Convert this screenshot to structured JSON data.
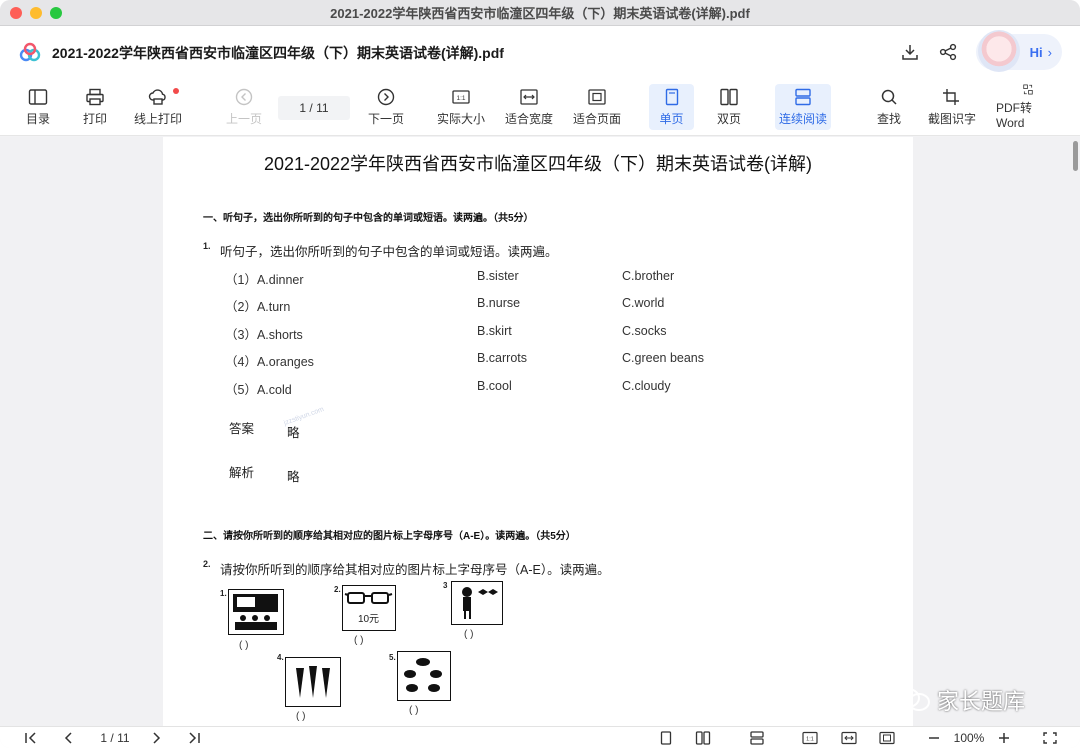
{
  "window": {
    "title": "2021-2022学年陕西省西安市临潼区四年级（下）期末英语试卷(详解).pdf"
  },
  "header": {
    "doc_title": "2021-2022学年陕西省西安市临潼区四年级（下）期末英语试卷(详解).pdf",
    "hi_label": "Hi",
    "icons": [
      "download-icon",
      "share-icon",
      "avatar-icon",
      "chevron-right-icon"
    ]
  },
  "toolbar": {
    "toc": "目录",
    "print": "打印",
    "online_print": "线上打印",
    "prev_page": "上一页",
    "page_indicator": "1  /  11",
    "next_page": "下一页",
    "actual_size": "实际大小",
    "fit_width": "适合宽度",
    "fit_page": "适合页面",
    "single_page": "单页",
    "double_page": "双页",
    "continuous": "连续阅读",
    "search": "查找",
    "ocr": "截图识字",
    "pdf_to_word": "PDF转Word",
    "actual_size_icon_text": "1:1"
  },
  "document": {
    "title": "2021-2022学年陕西省西安市临潼区四年级（下）期末英语试卷(详解)",
    "section1": "一、听句子，选出你所听到的句子中包含的单词或短语。读两遍。（共5分）",
    "q1_num": "1.",
    "q1_text": "听句子，选出你所听到的句子中包含的单词或短语。读两遍。",
    "options": [
      {
        "n": "（1）A.dinner",
        "b": "B.sister",
        "c": "C.brother"
      },
      {
        "n": "（2）A.turn",
        "b": "B.nurse",
        "c": "C.world"
      },
      {
        "n": "（3）A.shorts",
        "b": "B.skirt",
        "c": "C.socks"
      },
      {
        "n": "（4）A.oranges",
        "b": "B.carrots",
        "c": "C.green beans"
      },
      {
        "n": "（5）A.cold",
        "b": "B.cool",
        "c": "C.cloudy"
      }
    ],
    "answer_label": "答案",
    "answer_value": "略",
    "analysis_label": "解析",
    "analysis_value": "略",
    "section2": "二、请按你所听到的顺序给其相对应的图片标上字母序号（A-E）。读两遍。（共5分）",
    "q2_num": "2.",
    "q2_text": "请按你所听到的顺序给其相对应的图片标上字母序号（A-E）。读两遍。",
    "pictures": [
      {
        "num": "1.",
        "paren": "(        )"
      },
      {
        "num": "2.",
        "paren": "(        )",
        "price": "10元"
      },
      {
        "num": "3",
        "paren": "(        )"
      },
      {
        "num": "4.",
        "paren": "(        )"
      },
      {
        "num": "5.",
        "paren": "(        )"
      }
    ],
    "watermark_text": "jzzstiyun.com"
  },
  "wechat_overlay": "家长题库",
  "bottombar": {
    "page_indicator": "1  /  11",
    "zoom": "100%",
    "ratio_text": "1:1"
  }
}
